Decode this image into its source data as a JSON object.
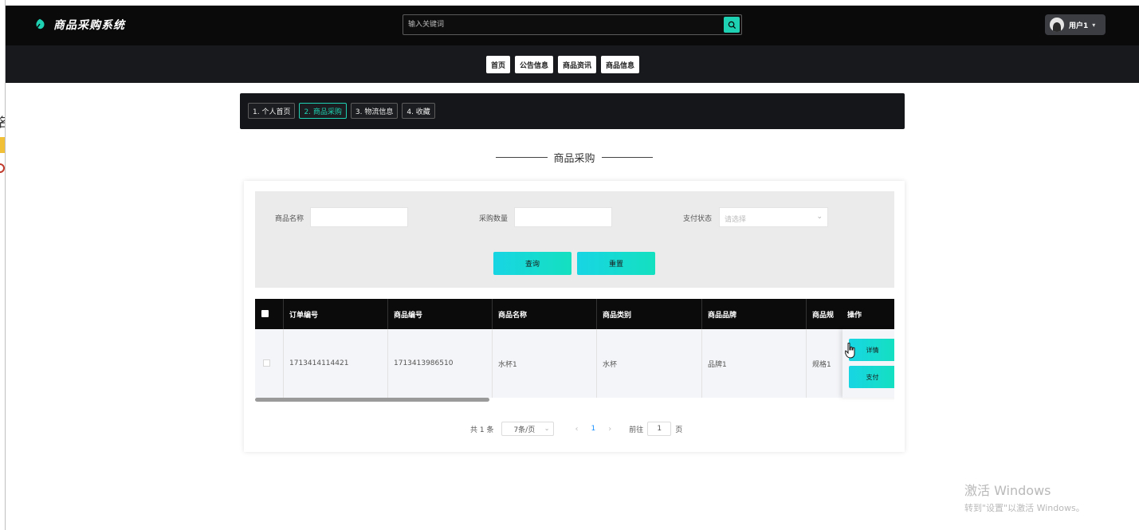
{
  "app": {
    "title": "商品采购系统"
  },
  "search": {
    "placeholder": "输入关键词"
  },
  "user": {
    "name": "用户1"
  },
  "nav": {
    "items": [
      "首页",
      "公告信息",
      "商品资讯",
      "商品信息"
    ]
  },
  "steps": {
    "items": [
      "1. 个人首页",
      "2. 商品采购",
      "3. 物流信息",
      "4. 收藏"
    ],
    "active_index": 1
  },
  "section": {
    "title": "商品采购"
  },
  "filter": {
    "name_label": "商品名称",
    "qty_label": "采购数量",
    "status_label": "支付状态",
    "status_placeholder": "请选择",
    "query_label": "查询",
    "reset_label": "重置"
  },
  "table": {
    "columns": [
      "订单编号",
      "商品编号",
      "商品名称",
      "商品类别",
      "商品品牌",
      "商品规"
    ],
    "op_header": "操作",
    "rows": [
      {
        "cells": [
          "1713414114421",
          "1713413986510",
          "水杯1",
          "水杯",
          "品牌1",
          "规格1"
        ],
        "detail_label": "详情",
        "pay_label": "支付"
      }
    ]
  },
  "pagination": {
    "total": "共 1 条",
    "page_size": "7条/页",
    "current_page": "1",
    "goto_prefix": "前往",
    "goto_value": "1",
    "goto_suffix": "页"
  },
  "watermark": {
    "line1": "激活 Windows",
    "line2": "转到\"设置\"以激活 Windows。"
  },
  "colors": {
    "accent": "#1ed1b2",
    "header_bg": "#0a0a0b",
    "nav_bg": "#18191c"
  }
}
